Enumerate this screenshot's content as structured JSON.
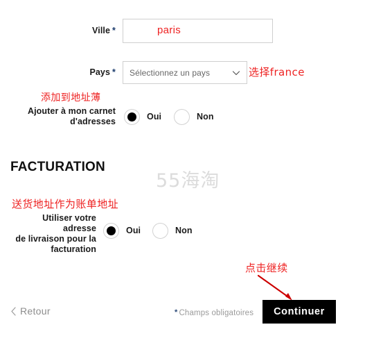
{
  "form": {
    "city": {
      "label": "Ville",
      "required_mark": "*",
      "value": "paris",
      "placeholder": ""
    },
    "country": {
      "label": "Pays",
      "required_mark": "*",
      "selected": "Sélectionnez un pays",
      "chevron_icon": "chevron-down-icon"
    },
    "address_book": {
      "label_line1": "Ajouter à mon carnet",
      "label_line2": "d'adresses",
      "options": [
        {
          "label": "Oui",
          "checked": true
        },
        {
          "label": "Non",
          "checked": false
        }
      ]
    }
  },
  "billing": {
    "title": "FACTURATION",
    "use_shipping": {
      "label_line1": "Utiliser votre adresse",
      "label_line2": "de livraison pour la",
      "label_line3": "facturation",
      "options": [
        {
          "label": "Oui",
          "checked": true
        },
        {
          "label": "Non",
          "checked": false
        }
      ]
    }
  },
  "footer": {
    "back_label": "Retour",
    "back_icon": "chevron-left-icon",
    "mandatory_star": "*",
    "mandatory_note": "Champs obligatoires",
    "continue_label": "Continuer"
  },
  "annotations": {
    "city_value": "paris",
    "country_hint": "选择france",
    "address_book_hint": "添加到地址薄",
    "billing_hint": "送货地址作为账单地址",
    "continue_hint": "点击继续",
    "arrow_icon": "red-arrow-icon"
  },
  "watermark": {
    "text": "55海淘"
  },
  "colors": {
    "annotation_red": "#ee2222",
    "button_black": "#000000",
    "border_gray": "#cfcfcf",
    "muted_gray": "#9b9b9b",
    "watermark_gray": "#dcdcdc"
  }
}
